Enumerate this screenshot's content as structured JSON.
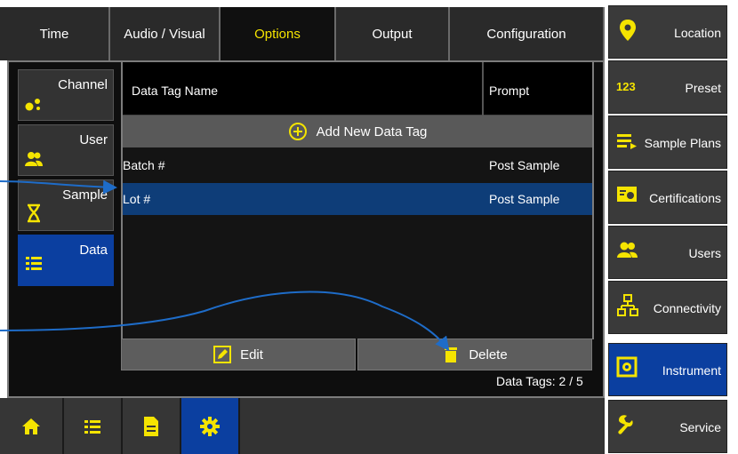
{
  "tabs": [
    {
      "label": "Time"
    },
    {
      "label": "Audio / Visual"
    },
    {
      "label": "Options"
    },
    {
      "label": "Output"
    },
    {
      "label": "Configuration"
    }
  ],
  "active_tab": "Options",
  "subnav": [
    {
      "label": "Channel"
    },
    {
      "label": "User"
    },
    {
      "label": "Sample"
    },
    {
      "label": "Data"
    }
  ],
  "table": {
    "headers": {
      "name": "Data Tag Name",
      "prompt": "Prompt"
    },
    "add_label": "Add New Data Tag",
    "rows": [
      {
        "name": "Batch #",
        "prompt": "Post Sample"
      },
      {
        "name": "Lot #",
        "prompt": "Post Sample"
      }
    ]
  },
  "actions": {
    "edit": "Edit",
    "delete": "Delete"
  },
  "count_label": "Data Tags: 2 / 5",
  "sidebar": [
    {
      "label": "Location",
      "icon": "location-pin-icon"
    },
    {
      "label": "Preset",
      "icon": "number-123-icon"
    },
    {
      "label": "Sample Plans",
      "icon": "list-arrow-icon"
    },
    {
      "label": "Certifications",
      "icon": "certificate-icon"
    },
    {
      "label": "Users",
      "icon": "users-icon"
    },
    {
      "label": "Connectivity",
      "icon": "network-icon"
    },
    {
      "label": "Instrument",
      "icon": "instrument-icon"
    },
    {
      "label": "Service",
      "icon": "wrench-icon"
    }
  ],
  "colors": {
    "accent": "#f5e400",
    "selected": "#0b3fa0",
    "row_selected": "#0e3d78",
    "annotation": "#1e6cc8"
  }
}
